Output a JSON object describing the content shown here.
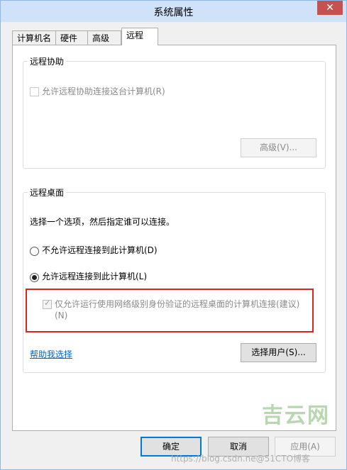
{
  "window": {
    "title": "系统属性",
    "close_glyph": "✕"
  },
  "tabs": [
    {
      "label": "计算机名",
      "active": false
    },
    {
      "label": "硬件",
      "active": false
    },
    {
      "label": "高级",
      "active": false
    },
    {
      "label": "远程",
      "active": true
    }
  ],
  "remote_assistance": {
    "legend": "远程协助",
    "allow_label": "允许远程协助连接这台计算机(R)",
    "allow_checked": false,
    "advanced_button": "高级(V)..."
  },
  "remote_desktop": {
    "legend": "远程桌面",
    "description": "选择一个选项，然后指定谁可以连接。",
    "options": [
      {
        "label": "不允许远程连接到此计算机(D)",
        "selected": false
      },
      {
        "label": "允许远程连接到此计算机(L)",
        "selected": true
      }
    ],
    "nla_label_line1": "仅允许运行使用网络级别身份验证的远程桌面的计算机连接(建议)",
    "nla_label_line2": "(N)",
    "nla_checked": true,
    "help_link": "帮助我选择",
    "select_users_button": "选择用户(S)..."
  },
  "footer": {
    "ok": "确定",
    "cancel": "取消",
    "apply": "应用(A)"
  },
  "watermarks": {
    "logo": "吉云网",
    "url": "https://blog.csdn.ne@51CTO博客"
  },
  "colors": {
    "highlight_box": "#d9261c",
    "link": "#0066cc"
  }
}
